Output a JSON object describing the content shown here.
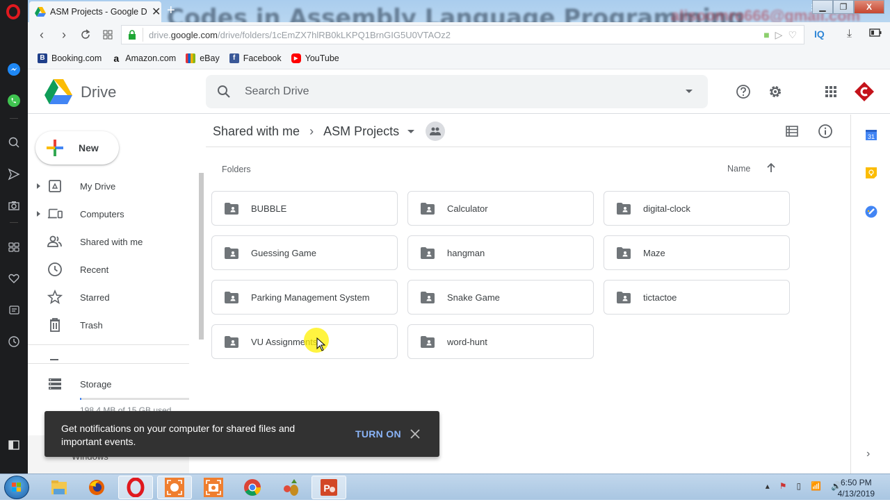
{
  "browser": {
    "tab_title": "ASM Projects - Google Dri",
    "background_text": "Codes in Assembly Language Programming",
    "background_email": "alisoomro666@gmail.com",
    "url_host": "drive.",
    "url_domain": "google.com",
    "url_path": "/drive/folders/1cEmZX7hlRB0kLKPQ1BrnGIG5U0VTAOz2",
    "iq_label": "IQ",
    "window_close": "X"
  },
  "bookmarks": [
    {
      "label": "Booking.com",
      "icon": "booking-icon",
      "glyph": "B",
      "color": "#1f3f8a"
    },
    {
      "label": "Amazon.com",
      "icon": "amazon-icon",
      "glyph": "a",
      "color": "#111111"
    },
    {
      "label": "eBay",
      "icon": "ebay-icon",
      "glyph": "",
      "color": "#e53238"
    },
    {
      "label": "Facebook",
      "icon": "facebook-icon",
      "glyph": "f",
      "color": "#3b5998"
    },
    {
      "label": "YouTube",
      "icon": "youtube-icon",
      "glyph": "▶",
      "color": "#ff0000"
    }
  ],
  "drive": {
    "app_title": "Drive",
    "search_placeholder": "Search Drive",
    "new_button": "New",
    "nav": [
      {
        "label": "My Drive",
        "icon": "my-drive-icon",
        "expandable": true
      },
      {
        "label": "Computers",
        "icon": "computers-icon",
        "expandable": true
      },
      {
        "label": "Shared with me",
        "icon": "shared-with-me-icon",
        "expandable": false
      },
      {
        "label": "Recent",
        "icon": "recent-icon",
        "expandable": false
      },
      {
        "label": "Starred",
        "icon": "starred-icon",
        "expandable": false
      },
      {
        "label": "Trash",
        "icon": "trash-icon",
        "expandable": false
      }
    ],
    "storage_label": "Storage",
    "storage_used_text": "198.4 MB of 15 GB used",
    "storage_fraction": 0.013,
    "bottom_text": "Windows",
    "breadcrumb": {
      "parent": "Shared with me",
      "current": "ASM Projects"
    },
    "folders_label": "Folders",
    "sort_label": "Name",
    "folders": [
      "BUBBLE",
      "Calculator",
      "digital-clock",
      "Guessing Game",
      "hangman",
      "Maze",
      "Parking Management System",
      "Snake Game",
      "tictactoe",
      "VU Assignments",
      "word-hunt"
    ],
    "right_rail": [
      {
        "name": "calendar-icon",
        "text": "31",
        "color": "#4285f4"
      },
      {
        "name": "keep-icon",
        "text": "",
        "color": "#fbbc04"
      },
      {
        "name": "tasks-icon",
        "text": "",
        "color": "#4285f4"
      }
    ]
  },
  "snackbar": {
    "message": "Get notifications on your computer for shared files and important events.",
    "action": "TURN ON"
  },
  "taskbar": {
    "time": "6:50 PM",
    "date": "4/13/2019"
  }
}
